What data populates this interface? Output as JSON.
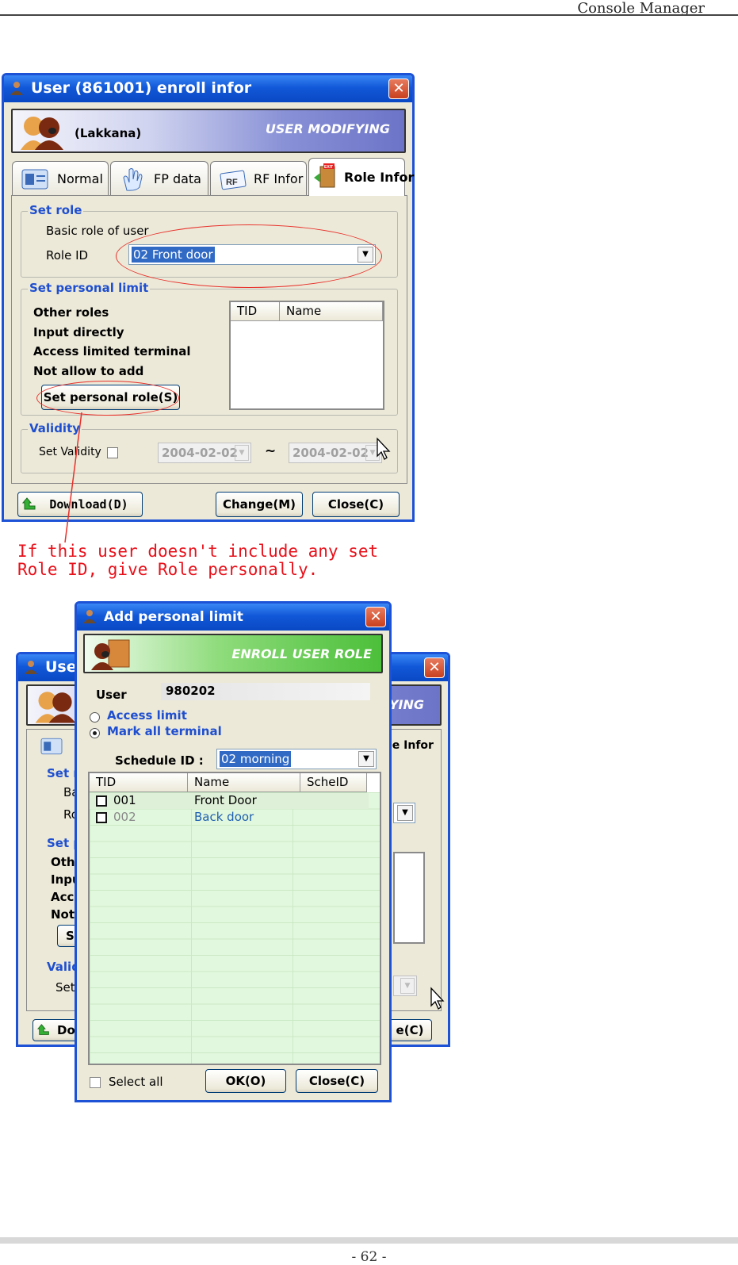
{
  "header": {
    "title": "Console Manager"
  },
  "footer": {
    "page": "- 62 -"
  },
  "dialog1": {
    "title": "User (861001) enroll infor",
    "user_name": "(Lakkana)",
    "mode": "USER MODIFYING",
    "tabs": [
      {
        "label": "Normal",
        "icon": "id-card-icon"
      },
      {
        "label": "FP data",
        "icon": "hand-icon"
      },
      {
        "label": "RF Infor",
        "icon": "rf-card-icon"
      },
      {
        "label": "Role Infor",
        "icon": "exit-door-icon"
      }
    ],
    "set_role": {
      "legend": "Set role",
      "basic": "Basic role of user",
      "role_id_label": "Role ID",
      "role_id_value": "02 Front door"
    },
    "personal": {
      "legend": "Set personal limit",
      "lines": [
        "Other roles",
        "Input directly",
        "Access limited terminal",
        "Not allow to add"
      ],
      "button": "Set personal role(S)",
      "columns": [
        "TID",
        "Name"
      ]
    },
    "validity": {
      "legend": "Validity",
      "label": "Set Validity",
      "from": "2004-02-02",
      "sep": "~",
      "to": "2004-02-02"
    },
    "buttons": {
      "download": "Download(D)",
      "change": "Change(M)",
      "close": "Close(C)"
    }
  },
  "note": {
    "line1": "If this user doesn't include any set",
    "line2": "Role ID, give Role personally."
  },
  "background_window": {
    "title": "Use",
    "mode": "YING",
    "tab": "le Infor",
    "labels": [
      "Set r",
      "Ba",
      "Ro",
      "Set p",
      "Othe",
      "Inpu",
      "Acc",
      "Not",
      "S",
      "Valid",
      "Set",
      "Do",
      "e(C)"
    ]
  },
  "dialog2": {
    "title": "Add personal limit",
    "banner": "ENROLL USER ROLE",
    "user_label": "User",
    "user_value": "980202",
    "radios": [
      {
        "label": "Access limit",
        "selected": false
      },
      {
        "label": "Mark all terminal",
        "selected": true
      }
    ],
    "schedule_label": "Schedule ID :",
    "schedule_value": "02 morning",
    "columns": [
      "TID",
      "Name",
      "ScheID"
    ],
    "rows": [
      {
        "tid": "001",
        "name": "Front Door",
        "schedid": ""
      },
      {
        "tid": "002",
        "name": "Back door",
        "schedid": ""
      }
    ],
    "select_all": "Select all",
    "ok": "OK(O)",
    "close": "Close(C)"
  }
}
